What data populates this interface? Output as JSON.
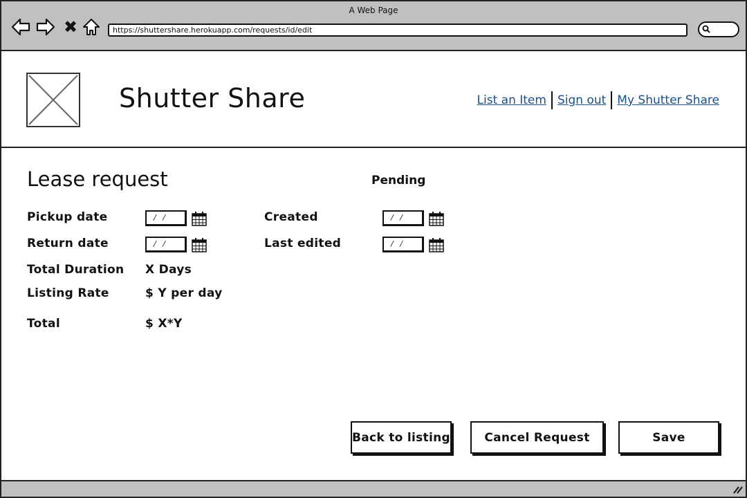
{
  "browser": {
    "window_title": "A Web Page",
    "url": "https://shuttershare.herokuapp.com/requests/id/edit",
    "icons": {
      "back": "back-arrow-icon",
      "forward": "forward-arrow-icon",
      "stop": "close-icon",
      "home": "home-icon",
      "search": "search-icon"
    },
    "stop_glyph": "✖"
  },
  "header": {
    "logo_icon": "image-placeholder-icon",
    "site_title": "Shutter Share",
    "links": [
      {
        "label": "List an Item"
      },
      {
        "label": "Sign out"
      },
      {
        "label": "My Shutter Share"
      }
    ],
    "link_color": "#1a4f8a"
  },
  "main": {
    "heading": "Lease request",
    "status": "Pending",
    "fields": {
      "pickup_date": {
        "label": "Pickup date",
        "value": "/ /"
      },
      "return_date": {
        "label": "Return date",
        "value": "/ /"
      },
      "created": {
        "label": "Created",
        "value": "/ /"
      },
      "last_edited": {
        "label": "Last edited",
        "value": "/ /"
      }
    },
    "summary": {
      "total_duration": {
        "label": "Total Duration",
        "value": "X Days"
      },
      "listing_rate": {
        "label": "Listing Rate",
        "value": "$ Y per day"
      },
      "total": {
        "label": "Total",
        "value": "$ X*Y"
      }
    }
  },
  "actions": {
    "back": "Back to listing",
    "cancel": "Cancel Request",
    "save": "Save"
  }
}
